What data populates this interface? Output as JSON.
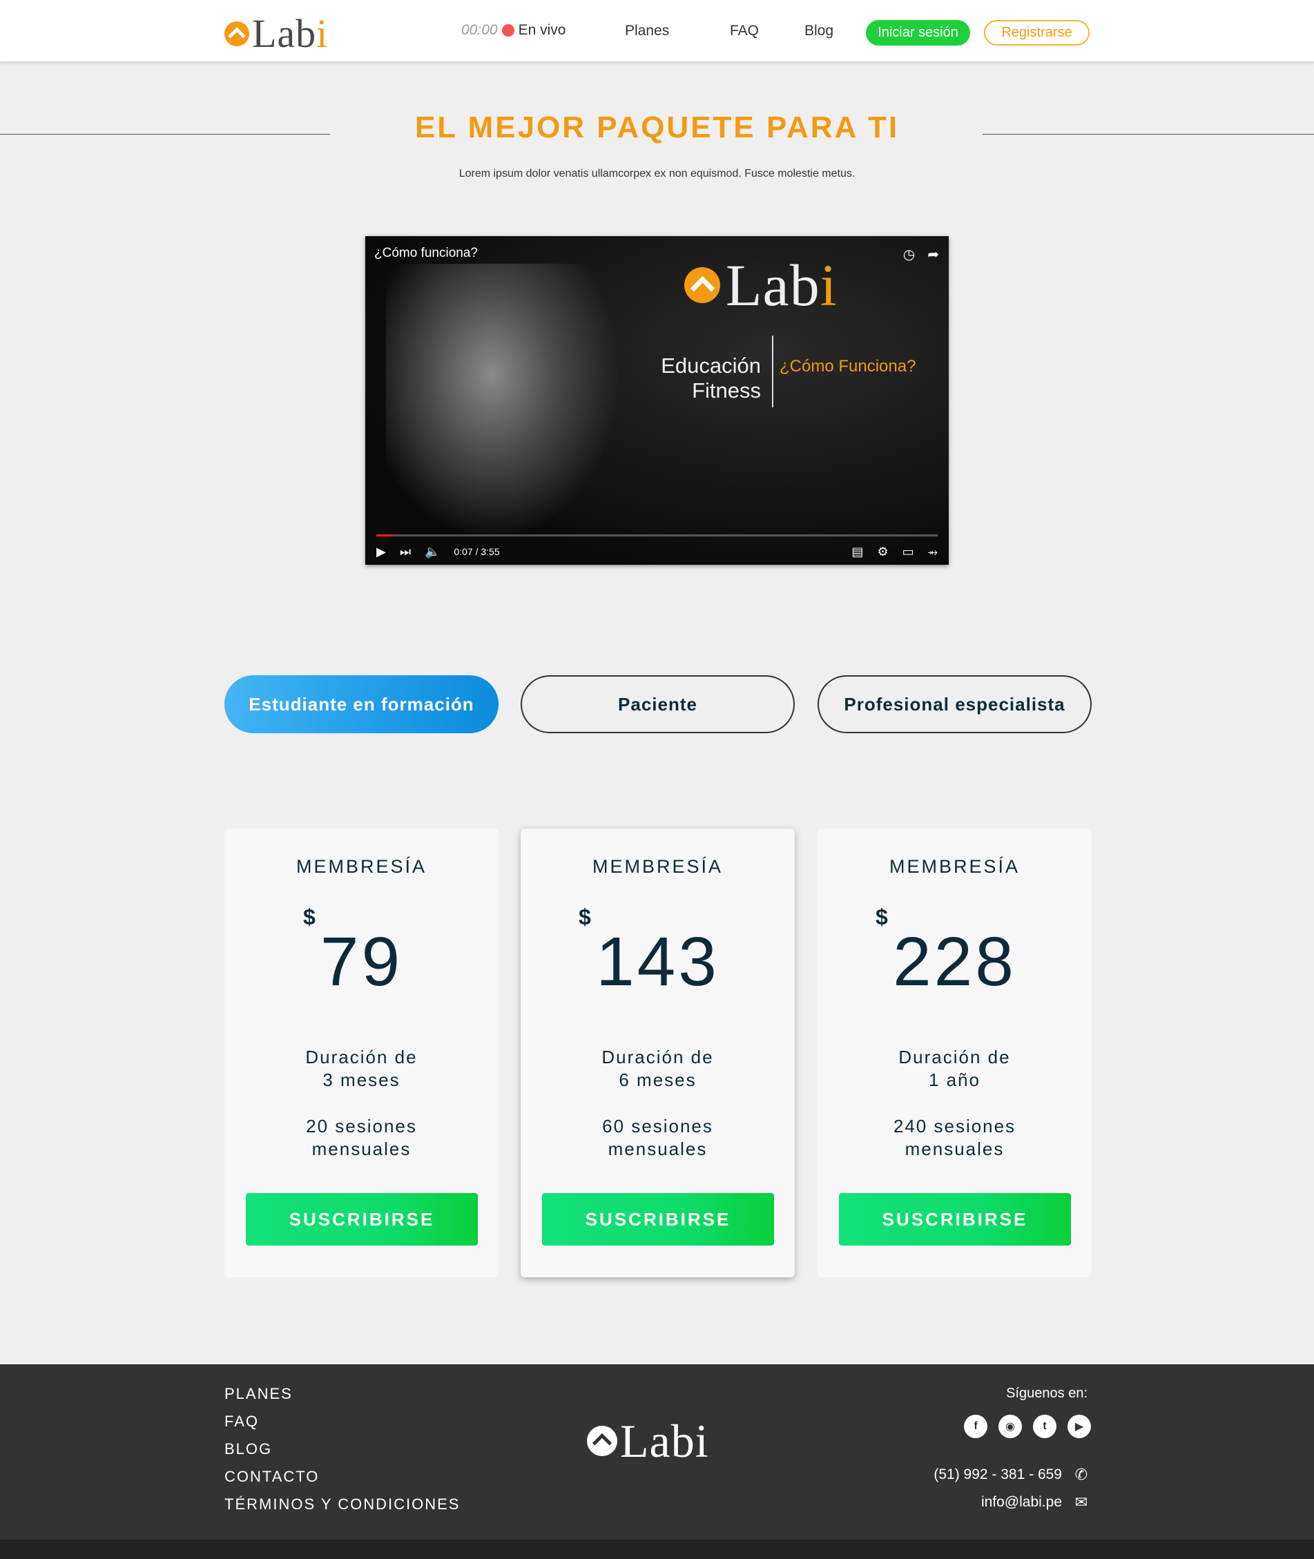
{
  "header": {
    "logo_main": "Lab",
    "logo_accent": "i",
    "live_time": "00:00",
    "live_label": "En vivo",
    "nav": [
      "Planes",
      "FAQ",
      "Blog"
    ],
    "login": "Iniciar sesión",
    "register": "Registrarse"
  },
  "hero": {
    "title": "EL MEJOR PAQUETE PARA TI",
    "subtitle": "Lorem ipsum dolor venatis ullamcorpex ex non equismod. Fusce molestie metus."
  },
  "video": {
    "title": "¿Cómo funciona?",
    "logo_main": "Lab",
    "logo_accent": "i",
    "edu_line1": "Educación",
    "edu_line2": "Fitness",
    "how": "¿Cómo Funciona?",
    "time": "0:07 / 3:55",
    "progress": 0.03
  },
  "tabs": [
    "Estudiante en formación",
    "Paciente",
    "Profesional especialista"
  ],
  "plans": [
    {
      "title": "MEMBRESÍA",
      "currency": "$",
      "price": "79",
      "duration_1": "Duración de",
      "duration_2": "3 meses",
      "sessions_1": "20 sesiones",
      "sessions_2": "mensuales",
      "cta": "SUSCRIBIRSE"
    },
    {
      "title": "MEMBRESÍA",
      "currency": "$",
      "price": "143",
      "duration_1": "Duración de",
      "duration_2": "6 meses",
      "sessions_1": "60 sesiones",
      "sessions_2": "mensuales",
      "cta": "SUSCRIBIRSE"
    },
    {
      "title": "MEMBRESÍA",
      "currency": "$",
      "price": "228",
      "duration_1": "Duración de",
      "duration_2": "1 año",
      "sessions_1": "240 sesiones",
      "sessions_2": "mensuales",
      "cta": "SUSCRIBIRSE"
    }
  ],
  "footer": {
    "links": [
      "PLANES",
      "FAQ",
      "BLOG",
      "CONTACTO",
      "TÉRMINOS Y CONDICIONES"
    ],
    "logo": "Labi",
    "follow": "Síguenos en:",
    "social": [
      "facebook-icon",
      "instagram-icon",
      "twitter-icon",
      "youtube-icon"
    ],
    "phone": "(51) 992 - 381 - 659",
    "email": "info@labi.pe"
  },
  "colors": {
    "brand_orange": "#f39a12",
    "login_green": "#1fcf3c",
    "tab_blue": "#2aa3ec",
    "cta_green": "#0edc6a",
    "footer_bg": "#333333"
  }
}
